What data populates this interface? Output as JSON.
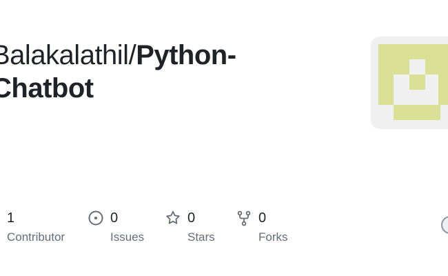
{
  "repo": {
    "owner": "Balakalathil/",
    "name": "Python-\nChatbot"
  },
  "stats": {
    "contributors": {
      "value": "1",
      "label": "Contributor"
    },
    "issues": {
      "value": "0",
      "label": "Issues",
      "icon": "issue-circle-icon"
    },
    "stars": {
      "value": "0",
      "label": "Stars",
      "icon": "star-icon"
    },
    "forks": {
      "value": "0",
      "label": "Forks",
      "icon": "fork-icon"
    }
  },
  "colors": {
    "identicon_fill": "#dadf96",
    "identicon_bg": "#f0f0f0",
    "text": "#1f2328",
    "muted": "#656d76"
  }
}
